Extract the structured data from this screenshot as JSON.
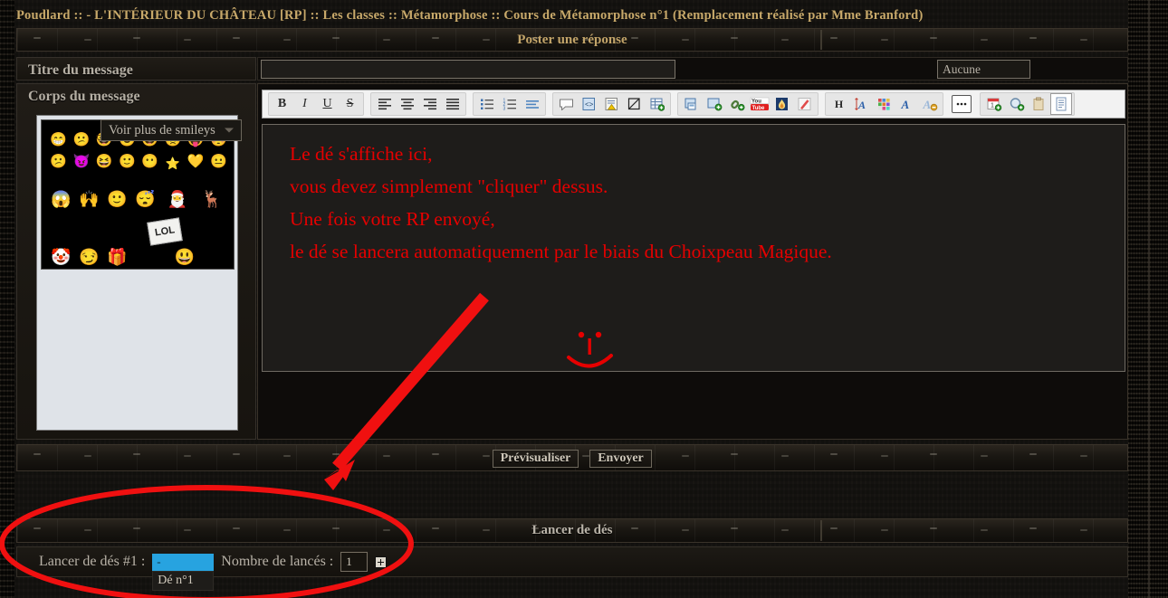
{
  "breadcrumb": {
    "items": [
      "Poudlard",
      "- L'INTÉRIEUR DU CHÂTEAU [RP]",
      "Les classes",
      "Métamorphose",
      "Cours de Métamorphose n°1 (Remplacement réalisé par Mme Branford)"
    ],
    "separator": "::",
    "full": "Poudlard  :: - L'INTÉRIEUR DU CHÂTEAU [RP] :: Les classes :: Métamorphose :: Cours de Métamorphose n°1 (Remplacement réalisé par Mme Branford)",
    "color": "#c8a96a"
  },
  "post_panel": {
    "header_title": "Poster une réponse",
    "title_label": "Titre du message",
    "title_value": "",
    "title_placeholder": "",
    "icon_select_value": "Aucune",
    "body_label": "Corps du message"
  },
  "smileys": {
    "more_label": "Voir plus de smileys",
    "rows": [
      [
        "😁",
        "😕",
        "🤓",
        "😎",
        "😆",
        "😠",
        "😛",
        "😳"
      ],
      [
        "😕",
        "😈",
        "😆",
        "🙂",
        "😶",
        "⭐",
        "💛",
        "😐"
      ],
      [
        "😱",
        "🙌",
        "🙂",
        "😴",
        "🎅",
        "🦌"
      ],
      [
        "🤡",
        "😏",
        "🎁",
        "😃"
      ]
    ]
  },
  "toolbar": {
    "groups": [
      {
        "name": "format",
        "buttons": [
          {
            "name": "bold-button",
            "glyph": "B",
            "cls": "b"
          },
          {
            "name": "italic-button",
            "glyph": "I",
            "cls": "i"
          },
          {
            "name": "underline-button",
            "glyph": "U",
            "cls": "u"
          },
          {
            "name": "strikethrough-button",
            "glyph": "S",
            "cls": "s"
          }
        ]
      },
      {
        "name": "align",
        "buttons": [
          {
            "name": "align-left-button",
            "icon": "align-left-icon"
          },
          {
            "name": "align-center-button",
            "icon": "align-center-icon"
          },
          {
            "name": "align-right-button",
            "icon": "align-right-icon"
          },
          {
            "name": "align-justify-button",
            "icon": "align-justify-icon"
          }
        ]
      },
      {
        "name": "lists",
        "buttons": [
          {
            "name": "bullet-list-button",
            "icon": "bullet-list-icon"
          },
          {
            "name": "numbered-list-button",
            "icon": "numbered-list-icon"
          },
          {
            "name": "indent-button",
            "icon": "indent-icon"
          }
        ]
      },
      {
        "name": "insert",
        "buttons": [
          {
            "name": "quote-button",
            "icon": "speech-bubble-icon"
          },
          {
            "name": "code-button",
            "icon": "code-icon"
          },
          {
            "name": "spoiler-button",
            "icon": "warning-note-icon"
          },
          {
            "name": "hide-button",
            "icon": "crossed-page-icon"
          },
          {
            "name": "table-button",
            "icon": "add-table-icon"
          }
        ]
      },
      {
        "name": "media",
        "buttons": [
          {
            "name": "insert-image-button",
            "icon": "image-icon"
          },
          {
            "name": "add-image-button",
            "icon": "add-image-icon"
          },
          {
            "name": "insert-link-button",
            "icon": "link-icon"
          },
          {
            "name": "youtube-button",
            "icon": "youtube-icon"
          },
          {
            "name": "flame-button",
            "icon": "flame-icon"
          },
          {
            "name": "pen-button",
            "icon": "pen-icon"
          }
        ]
      },
      {
        "name": "text-style",
        "buttons": [
          {
            "name": "heading-button",
            "glyph": "H",
            "cls": "h"
          },
          {
            "name": "font-size-button",
            "icon": "font-size-icon"
          },
          {
            "name": "font-color-button",
            "icon": "color-palette-icon"
          },
          {
            "name": "font-family-button",
            "icon": "font-family-icon"
          },
          {
            "name": "remove-format-button",
            "icon": "remove-format-icon"
          }
        ]
      },
      {
        "name": "more",
        "buttons": [
          {
            "name": "more-options-button",
            "icon": "ellipsis-icon"
          }
        ]
      },
      {
        "name": "tools",
        "buttons": [
          {
            "name": "calendar-button",
            "icon": "calendar-add-icon"
          },
          {
            "name": "search-add-button",
            "icon": "search-add-icon"
          },
          {
            "name": "paste-button",
            "icon": "clipboard-icon"
          },
          {
            "name": "preview-page-button",
            "icon": "document-icon"
          }
        ]
      }
    ]
  },
  "message_body": {
    "lines": [
      "Le dé s'affiche ici,",
      "vous devez simplement \"cliquer\" dessus.",
      "Une fois votre RP envoyé,",
      "le dé se lancera automatiquement par le biais du Choixpeau Magique."
    ],
    "text_color": "#e60000",
    "drawing": "red-smiley-face"
  },
  "actions": {
    "preview_label": "Prévisualiser",
    "submit_label": "Envoyer"
  },
  "dice": {
    "header_title": "Lancer de dés",
    "roll_label": "Lancer de dés #1 :",
    "select_value": "-",
    "select_option": "Dé n°1",
    "select_highlight_color": "#27a3e0",
    "count_label": "Nombre de lancés :",
    "count_value": "1",
    "add_button_label": "+"
  },
  "annotations": {
    "arrow_color": "#f01010",
    "ellipse_color": "#f01010"
  }
}
